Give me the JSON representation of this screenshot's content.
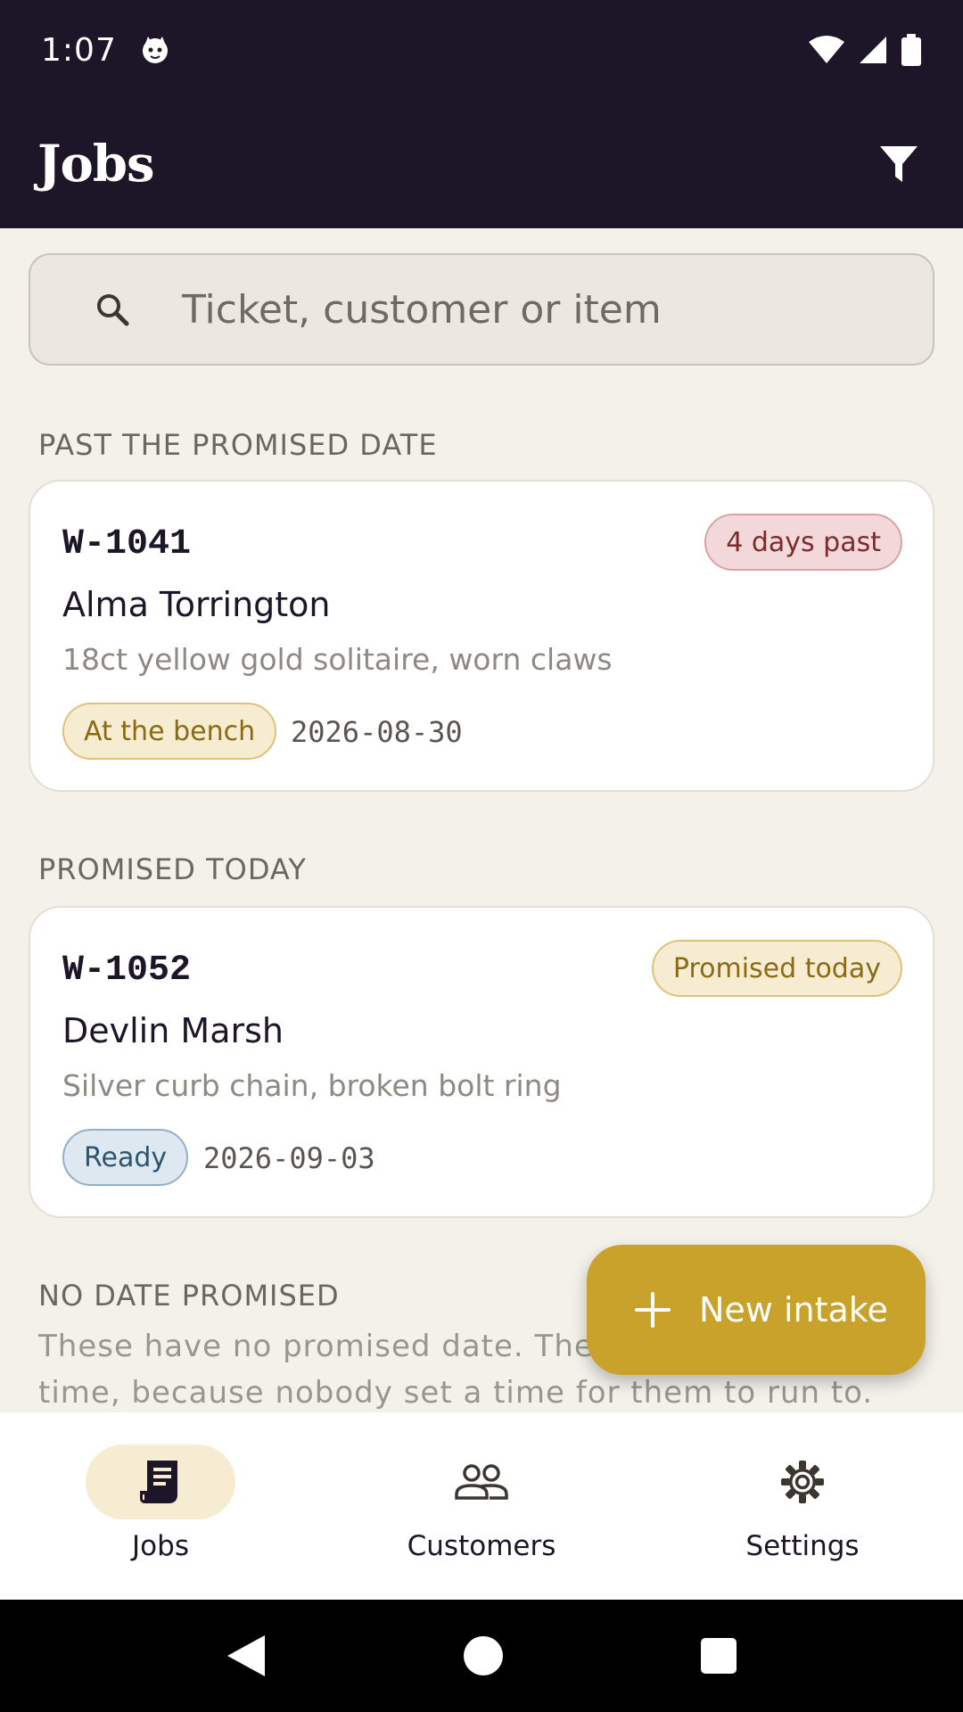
{
  "status_bar": {
    "time": "1:07",
    "icons": [
      "cat-notification-icon",
      "wifi-icon",
      "signal-icon",
      "battery-icon"
    ]
  },
  "app_bar": {
    "title": "Jobs",
    "filter_icon": "filter-icon"
  },
  "search": {
    "placeholder": "Ticket, customer or item",
    "icon": "search-icon"
  },
  "sections": [
    {
      "label": "PAST THE PROMISED DATE",
      "cards": [
        {
          "ticket": "W-1041",
          "due_badge": "4 days past",
          "customer": "Alma Torrington",
          "item": "18ct yellow gold solitaire, worn claws",
          "status": "At the bench",
          "promised_date": "2026-08-30"
        }
      ]
    },
    {
      "label": "PROMISED TODAY",
      "cards": [
        {
          "ticket": "W-1052",
          "due_badge": "Promised today",
          "customer": "Devlin Marsh",
          "item": "Silver curb chain, broken bolt ring",
          "status": "Ready",
          "promised_date": "2026-09-03"
        }
      ]
    },
    {
      "label": "NO DATE PROMISED",
      "note": "These have no promised date. They can't run out of time, because nobody set a time for them to run to."
    }
  ],
  "fab": {
    "label": "New intake",
    "icon": "plus-icon"
  },
  "bottom_nav": {
    "items": [
      {
        "label": "Jobs",
        "icon": "receipt-icon",
        "active": true
      },
      {
        "label": "Customers",
        "icon": "people-icon",
        "active": false
      },
      {
        "label": "Settings",
        "icon": "gear-icon",
        "active": false
      }
    ]
  },
  "colors": {
    "app_bar": "#1c1628",
    "background": "#f4f1eb",
    "accent": "#c9a22b",
    "late": "#7c2b2f",
    "ready": "#2f5470"
  }
}
